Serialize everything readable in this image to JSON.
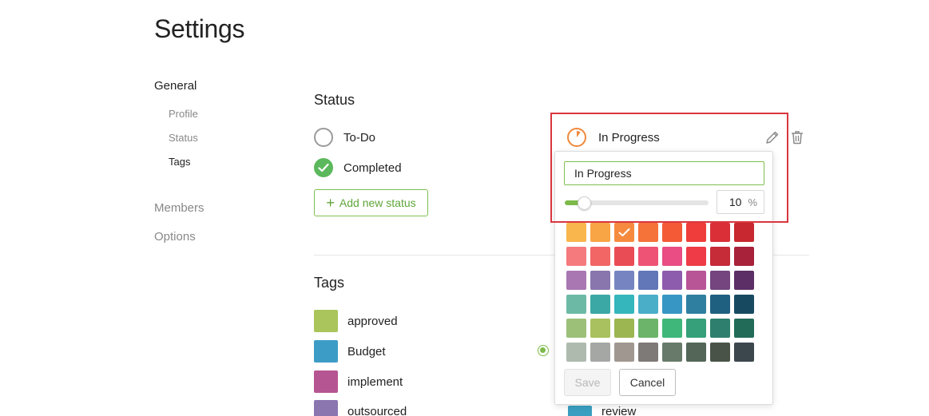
{
  "page": {
    "title": "Settings"
  },
  "nav": {
    "general": "General",
    "sub_items": [
      {
        "label": "Profile",
        "active": false
      },
      {
        "label": "Status",
        "active": false
      },
      {
        "label": "Tags",
        "active": true
      }
    ],
    "members": "Members",
    "options": "Options"
  },
  "status_section": {
    "title": "Status",
    "items": [
      {
        "label": "To-Do",
        "state": "empty"
      },
      {
        "label": "Completed",
        "state": "done",
        "color": "#5cb85c"
      }
    ],
    "add_button": {
      "icon": "plus-icon",
      "label": "Add new status"
    }
  },
  "editing_status": {
    "label": "In Progress",
    "progress_color": "#f0883a",
    "icons": {
      "edit": "pencil-icon",
      "delete": "trash-icon"
    },
    "popover": {
      "name_value": "In Progress",
      "percent": 10,
      "percent_unit": "%",
      "colors": [
        [
          "#f9b64c",
          "#f8a545",
          "#f68b3f",
          "#f57239",
          "#f45a36",
          "#ee3d3a",
          "#db2f38",
          "#c8282f"
        ],
        [
          "#f57a7d",
          "#f26665",
          "#ea4c55",
          "#ee5274",
          "#e94d84",
          "#ee3b47",
          "#c62b38",
          "#a8223a"
        ],
        [
          "#a977b2",
          "#8876ad",
          "#7685c2",
          "#6277b8",
          "#8e5cad",
          "#b85596",
          "#74457f",
          "#5c2f66"
        ],
        [
          "#6cbaa5",
          "#3ca8a5",
          "#35b6bc",
          "#4aaec8",
          "#3896c4",
          "#2f7fa1",
          "#1f5f80",
          "#174a61"
        ],
        [
          "#9dc078",
          "#a9c15e",
          "#9cb652",
          "#6bb46a",
          "#3fb77a",
          "#36a07a",
          "#2e7f6d",
          "#236b59"
        ],
        [
          "#aebaae",
          "#a4a7a4",
          "#a09791",
          "#7d7a77",
          "#687a6a",
          "#536658",
          "#4a5348",
          "#3c464d"
        ]
      ],
      "selected_color": "#f68b3f",
      "save_label": "Save",
      "cancel_label": "Cancel"
    }
  },
  "tags_section": {
    "title": "Tags",
    "items": [
      {
        "label": "approved",
        "color": "#a9c55b"
      },
      {
        "label": "Budget",
        "color": "#3d9cc6"
      },
      {
        "label": "implement",
        "color": "#b55592"
      },
      {
        "label": "outsourced",
        "color": "#8b76b0"
      }
    ],
    "right_column": [
      {
        "label": "review",
        "color": "#3a9fc0"
      }
    ],
    "globe_icon": "globe-icon"
  }
}
